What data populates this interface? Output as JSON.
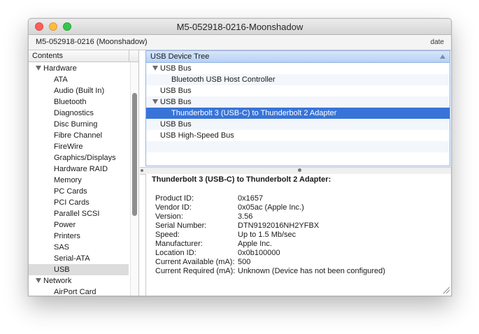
{
  "window": {
    "title": "M5-052918-0216-Moonshadow"
  },
  "infobar": {
    "machine": "M5-052918-0216 (Moonshadow)",
    "date_label": "date"
  },
  "sidebar": {
    "header": "Contents",
    "items": [
      {
        "label": "Hardware",
        "type": "group",
        "selected": false
      },
      {
        "label": "ATA",
        "type": "child",
        "selected": false
      },
      {
        "label": "Audio (Built In)",
        "type": "child",
        "selected": false
      },
      {
        "label": "Bluetooth",
        "type": "child",
        "selected": false
      },
      {
        "label": "Diagnostics",
        "type": "child",
        "selected": false
      },
      {
        "label": "Disc Burning",
        "type": "child",
        "selected": false
      },
      {
        "label": "Fibre Channel",
        "type": "child",
        "selected": false
      },
      {
        "label": "FireWire",
        "type": "child",
        "selected": false
      },
      {
        "label": "Graphics/Displays",
        "type": "child",
        "selected": false
      },
      {
        "label": "Hardware RAID",
        "type": "child",
        "selected": false
      },
      {
        "label": "Memory",
        "type": "child",
        "selected": false
      },
      {
        "label": "PC Cards",
        "type": "child",
        "selected": false
      },
      {
        "label": "PCI Cards",
        "type": "child",
        "selected": false
      },
      {
        "label": "Parallel SCSI",
        "type": "child",
        "selected": false
      },
      {
        "label": "Power",
        "type": "child",
        "selected": false
      },
      {
        "label": "Printers",
        "type": "child",
        "selected": false
      },
      {
        "label": "SAS",
        "type": "child",
        "selected": false
      },
      {
        "label": "Serial-ATA",
        "type": "child",
        "selected": false
      },
      {
        "label": "USB",
        "type": "child",
        "selected": true
      },
      {
        "label": "Network",
        "type": "group",
        "selected": false
      },
      {
        "label": "AirPort Card",
        "type": "child",
        "selected": false
      }
    ]
  },
  "tree": {
    "header": "USB Device Tree",
    "rows": [
      {
        "label": "USB Bus",
        "level": 0,
        "expanded": true,
        "selected": false
      },
      {
        "label": "Bluetooth USB Host Controller",
        "level": 1,
        "expanded": false,
        "selected": false
      },
      {
        "label": "USB Bus",
        "level": 0,
        "expanded": false,
        "selected": false
      },
      {
        "label": "USB Bus",
        "level": 0,
        "expanded": true,
        "selected": false
      },
      {
        "label": "Thunderbolt 3 (USB-C) to Thunderbolt 2 Adapter",
        "level": 1,
        "expanded": false,
        "selected": true
      },
      {
        "label": "USB Bus",
        "level": 0,
        "expanded": false,
        "selected": false
      },
      {
        "label": "USB High-Speed Bus",
        "level": 0,
        "expanded": false,
        "selected": false
      },
      {
        "label": "",
        "level": 0,
        "expanded": false,
        "selected": false
      }
    ]
  },
  "detail": {
    "title": "Thunderbolt 3 (USB-C) to Thunderbolt 2 Adapter:",
    "properties": [
      {
        "label": "Product ID:",
        "value": "0x1657"
      },
      {
        "label": "Vendor ID:",
        "value": "0x05ac  (Apple Inc.)"
      },
      {
        "label": "Version:",
        "value": "3.56"
      },
      {
        "label": "Serial Number:",
        "value": "DTN9192016NH2YFBX"
      },
      {
        "label": "Speed:",
        "value": "Up to 1.5 Mb/sec"
      },
      {
        "label": "Manufacturer:",
        "value": "Apple Inc."
      },
      {
        "label": "Location ID:",
        "value": "0x0b100000"
      },
      {
        "label": "Current Available (mA):",
        "value": "500"
      },
      {
        "label": "Current Required (mA):",
        "value": "Unknown (Device has not been configured)"
      }
    ]
  },
  "colors": {
    "selection": "#3874d8",
    "sidebar_selection": "#dcdcdc",
    "tree_header": "#b7d1f4"
  }
}
